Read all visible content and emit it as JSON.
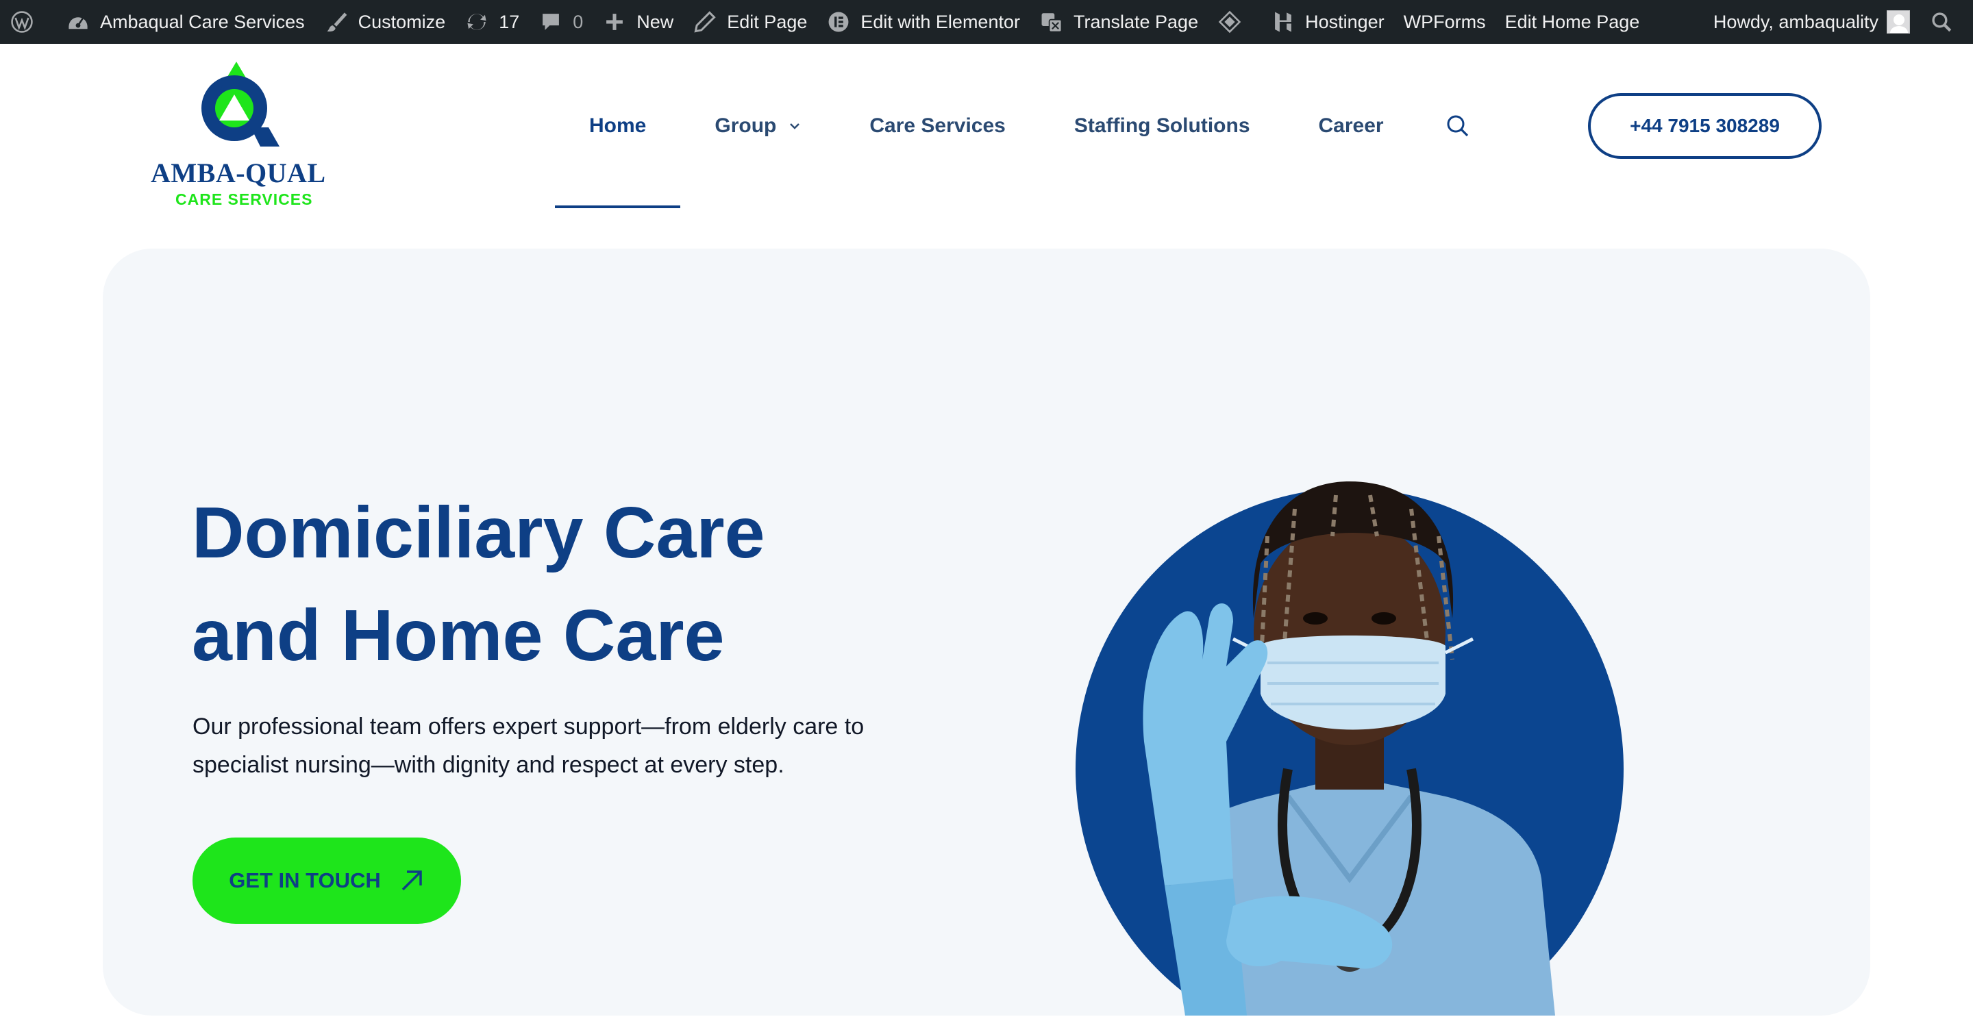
{
  "admin_bar": {
    "site_name": "Ambaqual Care Services",
    "customize": "Customize",
    "updates_count": "17",
    "comments_count": "0",
    "new": "New",
    "edit_page": "Edit Page",
    "edit_elementor": "Edit with Elementor",
    "translate": "Translate Page",
    "hostinger": "Hostinger",
    "wpforms": "WPForms",
    "edit_home": "Edit Home Page",
    "howdy": "Howdy, ambaquality"
  },
  "logo": {
    "title": "AMBA-QUAL",
    "subtitle": "CARE SERVICES"
  },
  "nav": {
    "items": [
      {
        "label": "Home",
        "active": true
      },
      {
        "label": "Group",
        "has_dropdown": true
      },
      {
        "label": "Care Services"
      },
      {
        "label": "Staffing Solutions"
      },
      {
        "label": "Career"
      }
    ]
  },
  "phone_button": "+44 7915 308289",
  "hero": {
    "title_line1": "Domiciliary Care",
    "title_line2": "and Home Care",
    "text_line1": "Our professional team offers expert support—from elderly care to",
    "text_line2": "specialist nursing—with dignity and respect at every step.",
    "cta": "GET IN TOUCH"
  },
  "colors": {
    "brand_blue": "#0e3f85",
    "brand_green": "#1ee51b",
    "admin_bar": "#1d2327",
    "hero_bg": "#f4f7fa"
  }
}
